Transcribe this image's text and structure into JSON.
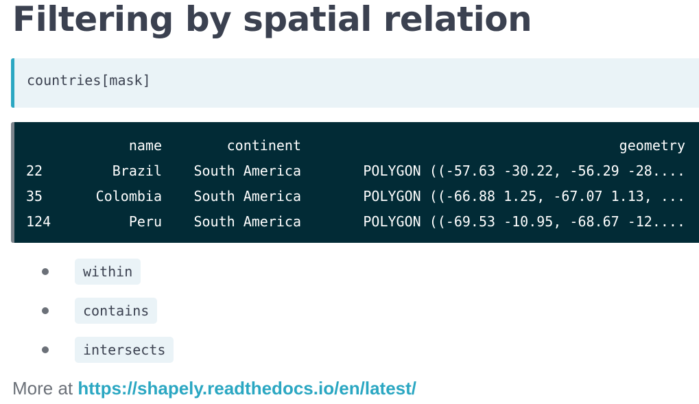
{
  "heading": {
    "title": "Filtering by spatial relation"
  },
  "code_input": {
    "code": "countries[mask]"
  },
  "code_output": {
    "columns": [
      "",
      "name",
      "continent",
      "geometry"
    ],
    "rows": [
      [
        "22",
        "Brazil",
        "South America",
        "POLYGON ((-57.63 -30.22, -56.29 -28...."
      ],
      [
        "35",
        "Colombia",
        "South America",
        "POLYGON ((-66.88 1.25, -67.07 1.13, ..."
      ],
      [
        "124",
        "Peru",
        "South America",
        "POLYGON ((-69.53 -10.95, -68.67 -12...."
      ]
    ]
  },
  "bullets": {
    "items": [
      "within",
      "contains",
      "intersects"
    ]
  },
  "more": {
    "prefix": "More at ",
    "link_text": "https://shapely.readthedocs.io/en/latest/"
  },
  "colors": {
    "title": "#3b4150",
    "input_background": "#eaf3f7",
    "input_accent": "#2ba7c2",
    "output_background": "#022b36",
    "output_accent": "#7d858d",
    "link": "#2ba7c2"
  }
}
